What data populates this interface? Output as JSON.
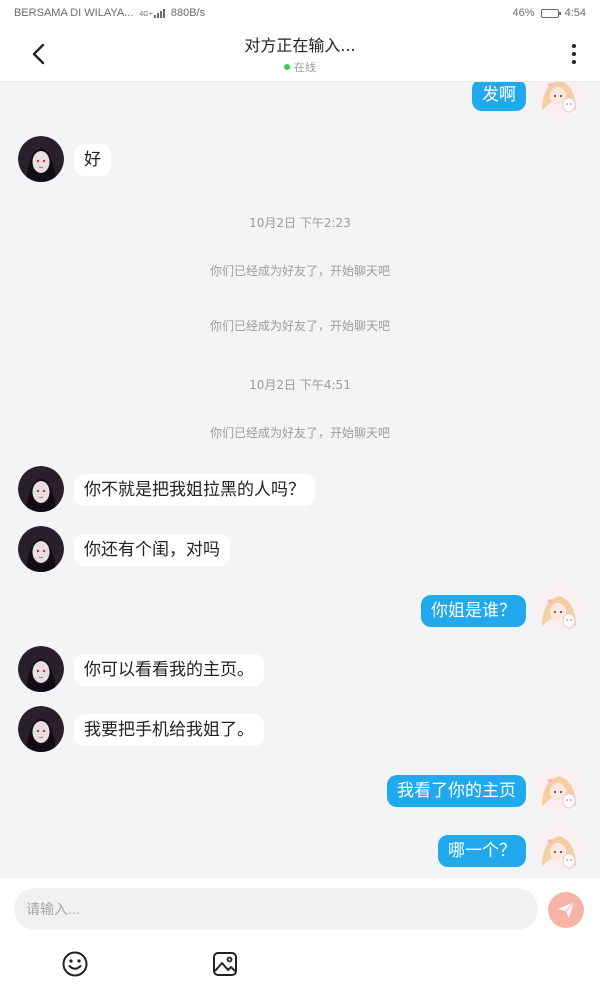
{
  "status_bar": {
    "carrier": "BERSAMA DI WILAYA...",
    "network_type": "4G+",
    "speed": "880B/s",
    "battery_percent": "46%",
    "battery_level": 0.46,
    "time": "4:54"
  },
  "header": {
    "title": "对方正在输入...",
    "status": "在线",
    "status_color": "#3fcc56"
  },
  "colors": {
    "outgoing_bubble": "#21a9ee",
    "incoming_bubble": "#ffffff",
    "send_button": "#f6b3a8"
  },
  "messages": [
    {
      "side": "out",
      "text": "发啊"
    },
    {
      "side": "in",
      "text": "好"
    },
    {
      "side": "system",
      "text": "10月2日 下午2:23"
    },
    {
      "side": "system",
      "text": "你们已经成为好友了，开始聊天吧"
    },
    {
      "side": "system",
      "text": "你们已经成为好友了，开始聊天吧"
    },
    {
      "side": "system",
      "text": "10月2日 下午4:51"
    },
    {
      "side": "system",
      "text": "你们已经成为好友了，开始聊天吧"
    },
    {
      "side": "in",
      "text": "你不就是把我姐拉黑的人吗？"
    },
    {
      "side": "in",
      "text": "你还有个闺，对吗"
    },
    {
      "side": "out",
      "text": "你姐是谁？"
    },
    {
      "side": "in",
      "text": "你可以看看我的主页。"
    },
    {
      "side": "in",
      "text": "我要把手机给我姐了。"
    },
    {
      "side": "out",
      "text": "我看了你的主页"
    },
    {
      "side": "out",
      "text": "哪一个？"
    }
  ],
  "composer": {
    "placeholder": "请输入...",
    "icons": [
      "emoji-icon",
      "image-icon",
      "send-icon"
    ]
  }
}
